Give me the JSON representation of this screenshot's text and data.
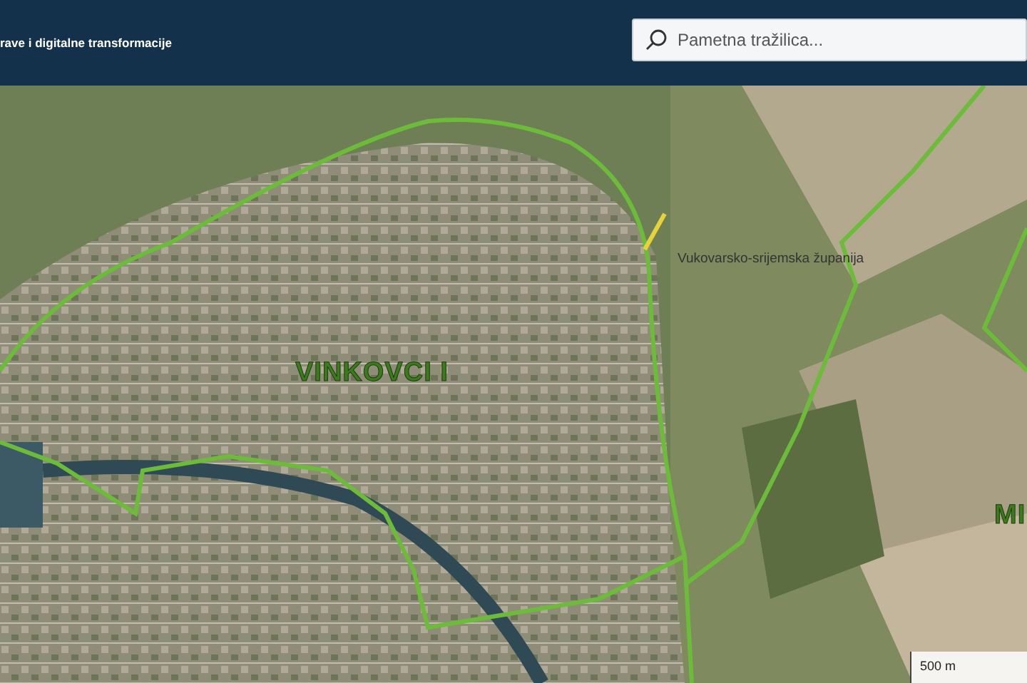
{
  "header": {
    "title": "rave i digitalne transformacije"
  },
  "search": {
    "placeholder": "Pametna tražilica..."
  },
  "map": {
    "labels": [
      {
        "kind": "county",
        "text": "Vukovarsko-srijemska županija"
      },
      {
        "kind": "municipality",
        "text": "VINKOVCI I"
      },
      {
        "kind": "municipality",
        "text": "MI"
      }
    ],
    "scale": {
      "text": "500 m"
    }
  }
}
